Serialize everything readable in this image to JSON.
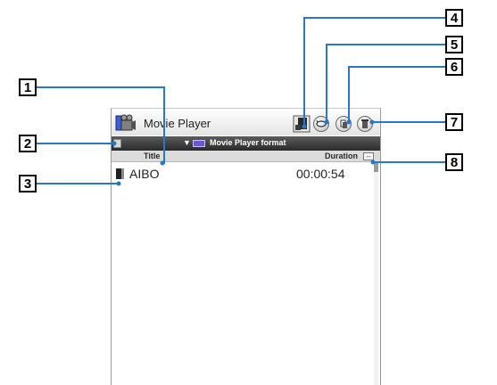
{
  "app": {
    "title": "Movie Player"
  },
  "folder": {
    "label": "Movie Player format"
  },
  "columns": {
    "title": "Title",
    "duration": "Duration"
  },
  "rows": [
    {
      "title": "AIBO",
      "duration": "00:00:54"
    }
  ],
  "callouts": [
    "1",
    "2",
    "3",
    "4",
    "5",
    "6",
    "7",
    "8"
  ],
  "icons": {
    "app": "movie-player-icon",
    "toolbar": [
      "memory-stick-icon",
      "play-mode-icon",
      "copy-icon",
      "delete-icon"
    ],
    "folder": "folder-icon",
    "file": "movie-file-icon",
    "sort": "sort-icon"
  }
}
